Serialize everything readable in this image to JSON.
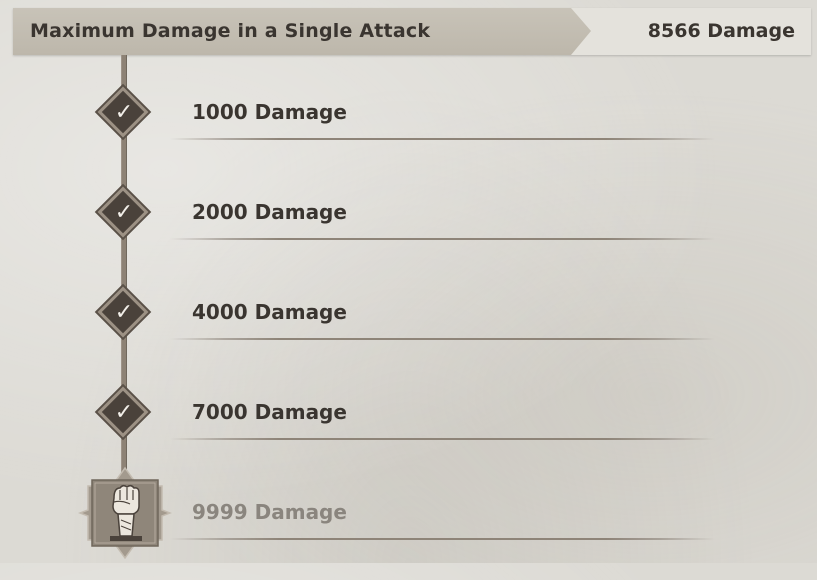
{
  "header": {
    "title": "Maximum Damage in a Single Attack",
    "current_value": "8566 Damage"
  },
  "milestones": [
    {
      "label": "1000 Damage",
      "completed": true,
      "icon": "check-icon"
    },
    {
      "label": "2000 Damage",
      "completed": true,
      "icon": "check-icon"
    },
    {
      "label": "4000 Damage",
      "completed": true,
      "icon": "check-icon"
    },
    {
      "label": "7000 Damage",
      "completed": true,
      "icon": "check-icon"
    },
    {
      "label": "9999 Damage",
      "completed": false,
      "icon": "fist-trophy-icon"
    }
  ],
  "colors": {
    "background": "#dcdad4",
    "header_band": "#bdb7ab",
    "text_dark": "#3a3530",
    "text_locked": "#8a857e",
    "timeline": "#8d8275",
    "diamond_fill": "#4a423b",
    "badge_fill": "#a39a8e"
  }
}
